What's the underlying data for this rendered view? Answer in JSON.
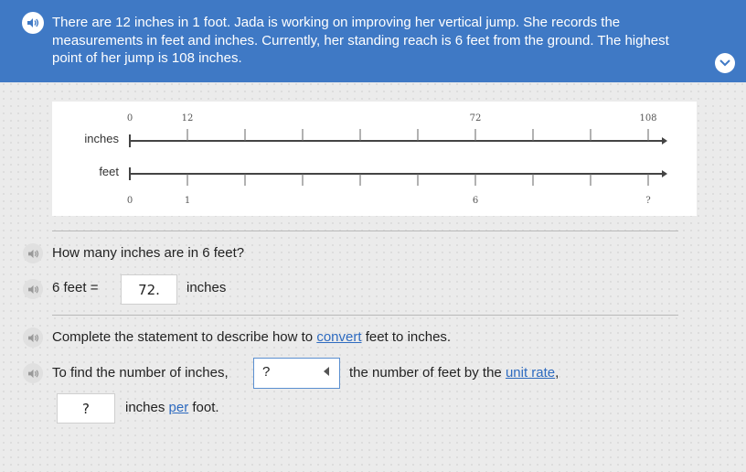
{
  "header": {
    "problem_text": "There are 12 inches in 1 foot. Jada is working on improving her vertical jump. She records the measurements in feet and inches. Currently, her standing reach is 6 feet from the ground. The highest point of her jump is 108 inches."
  },
  "number_line": {
    "inches_label": "inches",
    "feet_label": "feet",
    "inches_ticks": [
      "0",
      "12",
      "",
      "",
      "",
      "",
      "72",
      "",
      "",
      "108"
    ],
    "feet_ticks": [
      "0",
      "1",
      "",
      "",
      "",
      "",
      "6",
      "",
      "",
      "?"
    ]
  },
  "question1": {
    "text": "How many inches are in 6 feet?",
    "prefix": "6 feet =",
    "answer": "72.",
    "suffix": "inches"
  },
  "question2": {
    "prompt_before": "Complete the statement to describe how to ",
    "prompt_link": "convert",
    "prompt_after": " feet to inches.",
    "statement_before": "To find the number of inches,",
    "select_value": "?",
    "statement_mid": "the number of feet by the ",
    "unit_rate_link": "unit rate",
    "statement_comma": ",",
    "rate_input_value": "?",
    "statement_end_before": "inches ",
    "per_link": "per",
    "statement_end_after": " foot."
  },
  "colors": {
    "header_bg": "#3f79c5",
    "link": "#2e6bc0",
    "select_border": "#5a8fd0"
  },
  "icons": {
    "audio": "speaker-icon",
    "collapse": "chevron-down-icon",
    "select_caret": "caret-left-icon"
  }
}
